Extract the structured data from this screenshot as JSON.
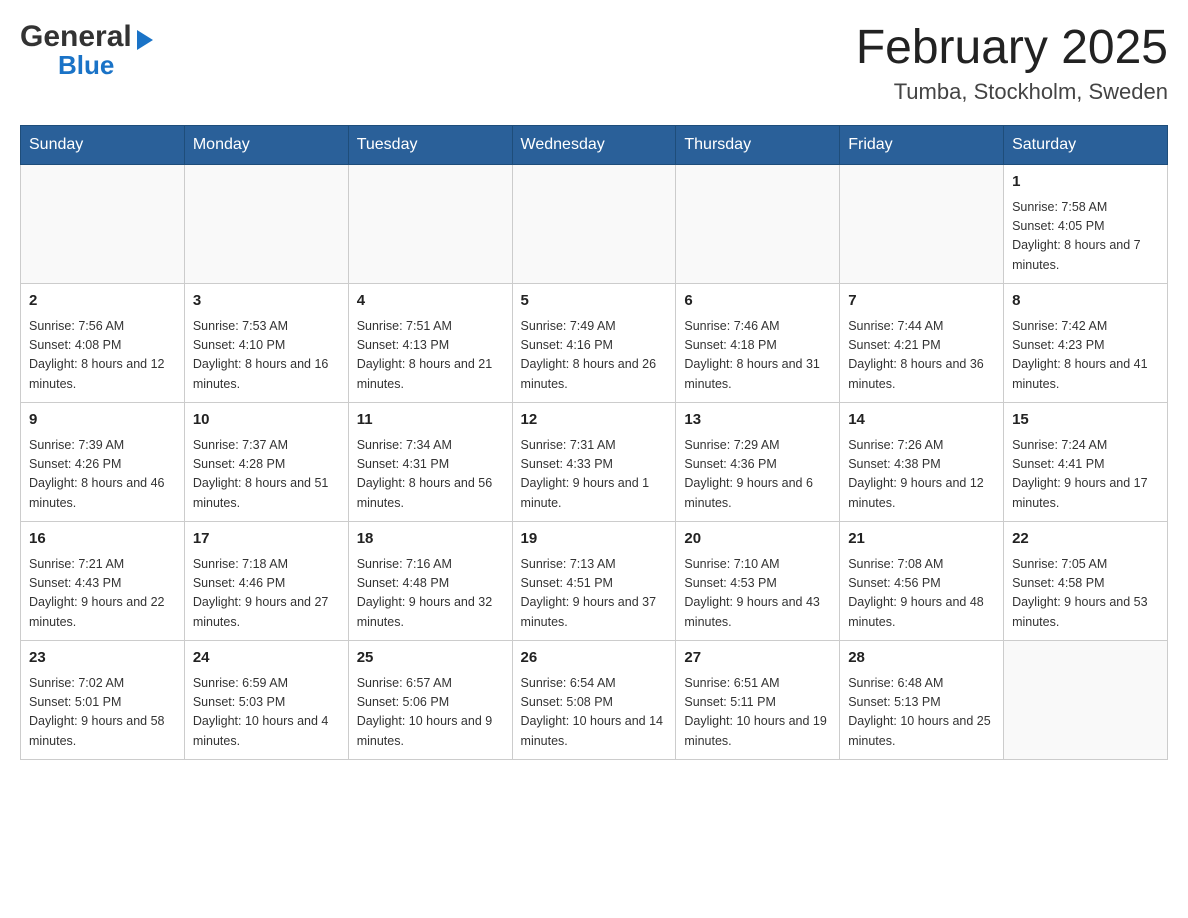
{
  "header": {
    "logo_general": "General",
    "logo_blue": "Blue",
    "month_title": "February 2025",
    "location": "Tumba, Stockholm, Sweden"
  },
  "weekdays": [
    "Sunday",
    "Monday",
    "Tuesday",
    "Wednesday",
    "Thursday",
    "Friday",
    "Saturday"
  ],
  "weeks": [
    {
      "days": [
        {
          "num": "",
          "info": ""
        },
        {
          "num": "",
          "info": ""
        },
        {
          "num": "",
          "info": ""
        },
        {
          "num": "",
          "info": ""
        },
        {
          "num": "",
          "info": ""
        },
        {
          "num": "",
          "info": ""
        },
        {
          "num": "1",
          "info": "Sunrise: 7:58 AM\nSunset: 4:05 PM\nDaylight: 8 hours and 7 minutes."
        }
      ]
    },
    {
      "days": [
        {
          "num": "2",
          "info": "Sunrise: 7:56 AM\nSunset: 4:08 PM\nDaylight: 8 hours and 12 minutes."
        },
        {
          "num": "3",
          "info": "Sunrise: 7:53 AM\nSunset: 4:10 PM\nDaylight: 8 hours and 16 minutes."
        },
        {
          "num": "4",
          "info": "Sunrise: 7:51 AM\nSunset: 4:13 PM\nDaylight: 8 hours and 21 minutes."
        },
        {
          "num": "5",
          "info": "Sunrise: 7:49 AM\nSunset: 4:16 PM\nDaylight: 8 hours and 26 minutes."
        },
        {
          "num": "6",
          "info": "Sunrise: 7:46 AM\nSunset: 4:18 PM\nDaylight: 8 hours and 31 minutes."
        },
        {
          "num": "7",
          "info": "Sunrise: 7:44 AM\nSunset: 4:21 PM\nDaylight: 8 hours and 36 minutes."
        },
        {
          "num": "8",
          "info": "Sunrise: 7:42 AM\nSunset: 4:23 PM\nDaylight: 8 hours and 41 minutes."
        }
      ]
    },
    {
      "days": [
        {
          "num": "9",
          "info": "Sunrise: 7:39 AM\nSunset: 4:26 PM\nDaylight: 8 hours and 46 minutes."
        },
        {
          "num": "10",
          "info": "Sunrise: 7:37 AM\nSunset: 4:28 PM\nDaylight: 8 hours and 51 minutes."
        },
        {
          "num": "11",
          "info": "Sunrise: 7:34 AM\nSunset: 4:31 PM\nDaylight: 8 hours and 56 minutes."
        },
        {
          "num": "12",
          "info": "Sunrise: 7:31 AM\nSunset: 4:33 PM\nDaylight: 9 hours and 1 minute."
        },
        {
          "num": "13",
          "info": "Sunrise: 7:29 AM\nSunset: 4:36 PM\nDaylight: 9 hours and 6 minutes."
        },
        {
          "num": "14",
          "info": "Sunrise: 7:26 AM\nSunset: 4:38 PM\nDaylight: 9 hours and 12 minutes."
        },
        {
          "num": "15",
          "info": "Sunrise: 7:24 AM\nSunset: 4:41 PM\nDaylight: 9 hours and 17 minutes."
        }
      ]
    },
    {
      "days": [
        {
          "num": "16",
          "info": "Sunrise: 7:21 AM\nSunset: 4:43 PM\nDaylight: 9 hours and 22 minutes."
        },
        {
          "num": "17",
          "info": "Sunrise: 7:18 AM\nSunset: 4:46 PM\nDaylight: 9 hours and 27 minutes."
        },
        {
          "num": "18",
          "info": "Sunrise: 7:16 AM\nSunset: 4:48 PM\nDaylight: 9 hours and 32 minutes."
        },
        {
          "num": "19",
          "info": "Sunrise: 7:13 AM\nSunset: 4:51 PM\nDaylight: 9 hours and 37 minutes."
        },
        {
          "num": "20",
          "info": "Sunrise: 7:10 AM\nSunset: 4:53 PM\nDaylight: 9 hours and 43 minutes."
        },
        {
          "num": "21",
          "info": "Sunrise: 7:08 AM\nSunset: 4:56 PM\nDaylight: 9 hours and 48 minutes."
        },
        {
          "num": "22",
          "info": "Sunrise: 7:05 AM\nSunset: 4:58 PM\nDaylight: 9 hours and 53 minutes."
        }
      ]
    },
    {
      "days": [
        {
          "num": "23",
          "info": "Sunrise: 7:02 AM\nSunset: 5:01 PM\nDaylight: 9 hours and 58 minutes."
        },
        {
          "num": "24",
          "info": "Sunrise: 6:59 AM\nSunset: 5:03 PM\nDaylight: 10 hours and 4 minutes."
        },
        {
          "num": "25",
          "info": "Sunrise: 6:57 AM\nSunset: 5:06 PM\nDaylight: 10 hours and 9 minutes."
        },
        {
          "num": "26",
          "info": "Sunrise: 6:54 AM\nSunset: 5:08 PM\nDaylight: 10 hours and 14 minutes."
        },
        {
          "num": "27",
          "info": "Sunrise: 6:51 AM\nSunset: 5:11 PM\nDaylight: 10 hours and 19 minutes."
        },
        {
          "num": "28",
          "info": "Sunrise: 6:48 AM\nSunset: 5:13 PM\nDaylight: 10 hours and 25 minutes."
        },
        {
          "num": "",
          "info": ""
        }
      ]
    }
  ]
}
